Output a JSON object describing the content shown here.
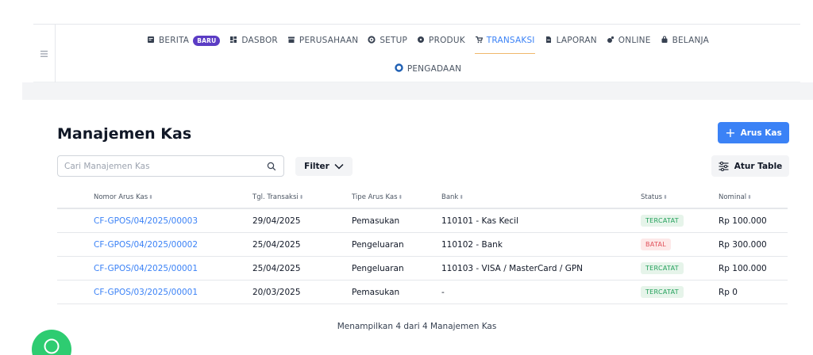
{
  "nav": {
    "items": [
      {
        "icon": "news-icon",
        "label": "BERITA",
        "badge": "BARU"
      },
      {
        "icon": "dashboard-icon",
        "label": "DASBOR"
      },
      {
        "icon": "building-icon",
        "label": "PERUSAHAAN"
      },
      {
        "icon": "gear-icon",
        "label": "SETUP"
      },
      {
        "icon": "box-icon",
        "label": "PRODUK"
      },
      {
        "icon": "cart-icon",
        "label": "TRANSAKSI",
        "active": true
      },
      {
        "icon": "report-icon",
        "label": "LAPORAN"
      },
      {
        "icon": "online-icon",
        "label": "ONLINE"
      },
      {
        "icon": "bag-icon",
        "label": "BELANJA"
      }
    ],
    "row2": {
      "icon": "procurement-icon",
      "label": "PENGADAAN"
    },
    "active_color": "#3b82f6"
  },
  "page": {
    "title": "Manajemen Kas",
    "add_button": "Arus Kas",
    "search_placeholder": "Cari Manajemen Kas",
    "filter_label": "Filter",
    "table_settings_label": "Atur Table"
  },
  "table": {
    "headers": [
      "Nomor Arus Kas",
      "Tgl. Transaksi",
      "Tipe Arus Kas",
      "Bank",
      "Status",
      "Nominal"
    ],
    "rows": [
      {
        "number": "CF-GPOS/04/2025/00003",
        "date": "29/04/2025",
        "type": "Pemasukan",
        "bank": "110101 - Kas Kecil",
        "status": "TERCATAT",
        "status_kind": "ok",
        "amount": "Rp 100.000"
      },
      {
        "number": "CF-GPOS/04/2025/00002",
        "date": "25/04/2025",
        "type": "Pengeluaran",
        "bank": "110102 - Bank",
        "status": "BATAL",
        "status_kind": "cancel",
        "amount": "Rp 300.000"
      },
      {
        "number": "CF-GPOS/04/2025/00001",
        "date": "25/04/2025",
        "type": "Pengeluaran",
        "bank": "110103 - VISA / MasterCard / GPN",
        "status": "TERCATAT",
        "status_kind": "ok",
        "amount": "Rp 100.000"
      },
      {
        "number": "CF-GPOS/03/2025/00001",
        "date": "20/03/2025",
        "type": "Pemasukan",
        "bank": "-",
        "status": "TERCATAT",
        "status_kind": "ok",
        "amount": "Rp 0"
      }
    ]
  },
  "footer": {
    "summary": "Menampilkan 4 dari 4 Manajemen Kas"
  },
  "colors": {
    "primary": "#3b82f6",
    "success": "#22a05b",
    "danger": "#e0505a",
    "badge": "#5b3cc4",
    "chat": "#2ecc71"
  }
}
